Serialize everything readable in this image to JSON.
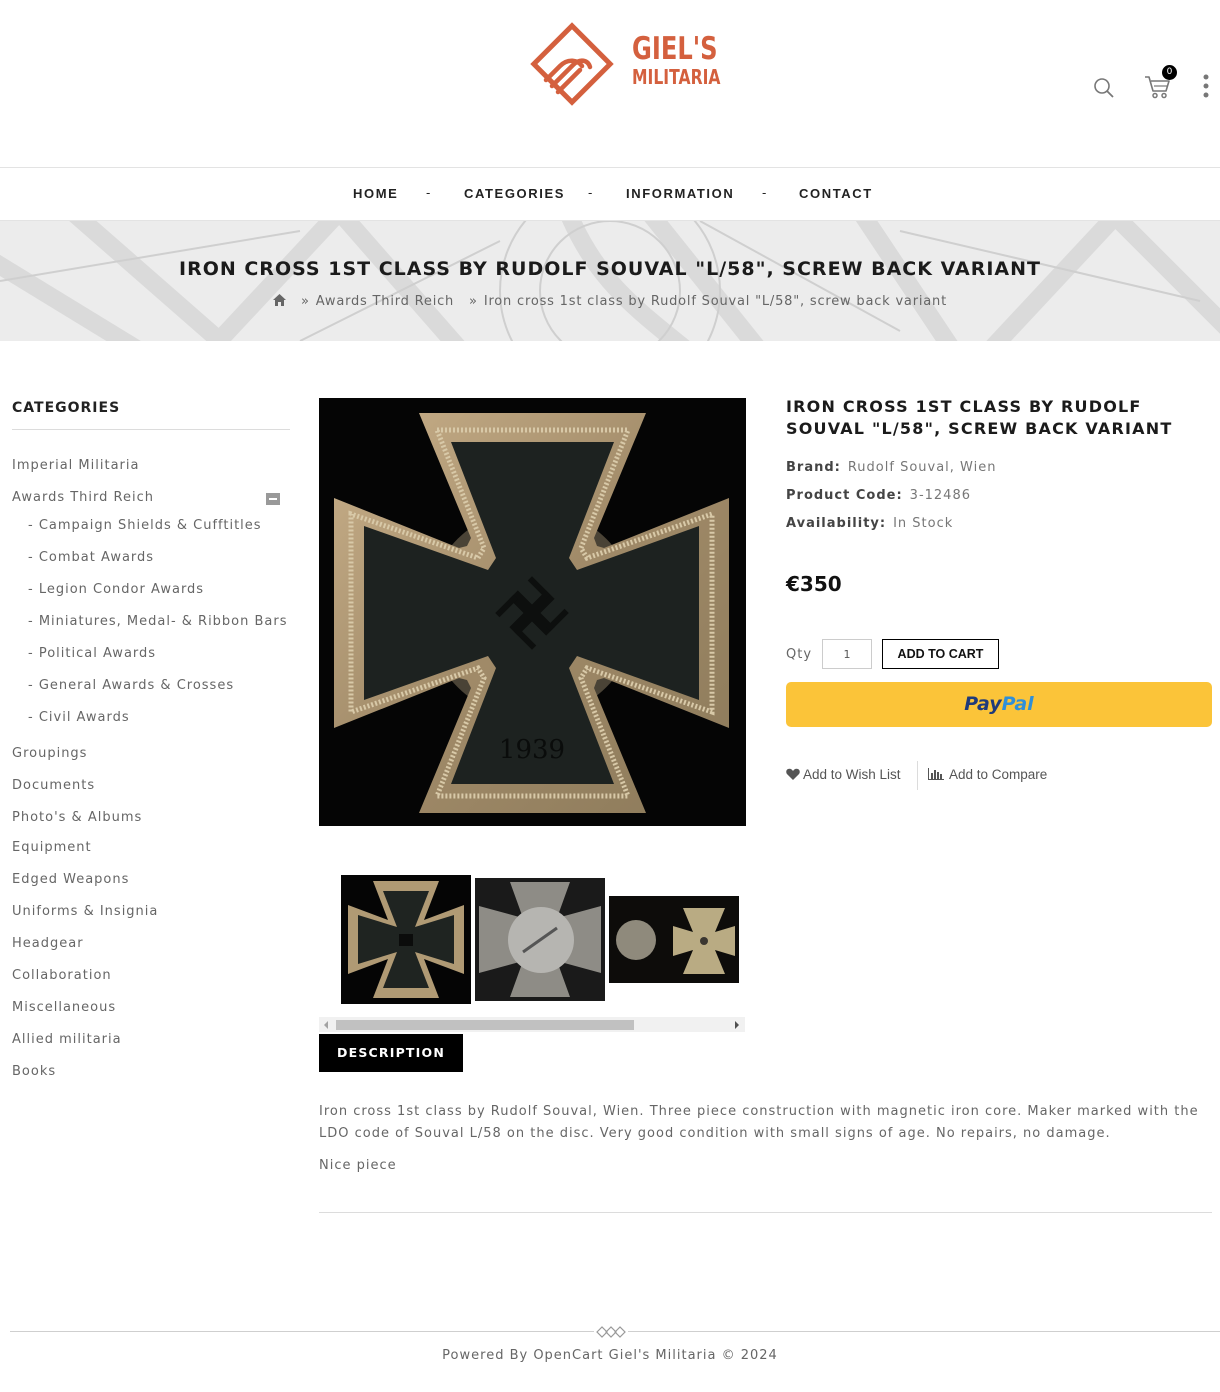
{
  "brand": {
    "line1": "GIEL'S",
    "line2": "MILITARIA",
    "color": "#d4603e"
  },
  "header": {
    "cart_count": "0",
    "icons": [
      "search-icon",
      "cart-icon",
      "more-vertical-icon"
    ]
  },
  "nav": {
    "items": [
      {
        "label": "HOME"
      },
      {
        "label": "CATEGORIES"
      },
      {
        "label": "INFORMATION"
      },
      {
        "label": "CONTACT"
      }
    ],
    "separator": "-"
  },
  "banner": {
    "title": "IRON CROSS 1ST CLASS BY RUDOLF SOUVAL \"L/58\", SCREW BACK VARIANT",
    "breadcrumbs": [
      {
        "label": "Awards Third Reich"
      },
      {
        "label": "Iron cross 1st class by Rudolf Souval \"L/58\", screw back variant"
      }
    ]
  },
  "sidebar": {
    "heading": "CATEGORIES",
    "items": [
      {
        "label": "Imperial Militaria"
      },
      {
        "label": "Awards Third Reich"
      },
      {
        "label": "- Campaign Shields & Cufftitles"
      },
      {
        "label": "- Combat Awards"
      },
      {
        "label": "- Legion Condor Awards"
      },
      {
        "label": "- Miniatures, Medal- & Ribbon Bars"
      },
      {
        "label": "- Political Awards"
      },
      {
        "label": "- General Awards & Crosses"
      },
      {
        "label": "- Civil Awards"
      },
      {
        "label": "Groupings"
      },
      {
        "label": "Documents"
      },
      {
        "label": "Photo's & Albums"
      },
      {
        "label": "Equipment"
      },
      {
        "label": "Edged Weapons"
      },
      {
        "label": "Uniforms & Insignia"
      },
      {
        "label": "Headgear"
      },
      {
        "label": "Collaboration"
      },
      {
        "label": "Miscellaneous"
      },
      {
        "label": "Allied militaria"
      },
      {
        "label": "Books"
      }
    ]
  },
  "product": {
    "title": "IRON CROSS 1ST CLASS BY RUDOLF SOUVAL \"L/58\", SCREW BACK VARIANT",
    "brand_label": "Brand:",
    "brand_value": "Rudolf Souval, Wien",
    "code_label": "Product Code:",
    "code_value": "3-12486",
    "availability_label": "Availability:",
    "availability_value": "In Stock",
    "price": "€350",
    "qty_label": "Qty",
    "qty_value": "1",
    "add_to_cart": "ADD TO CART",
    "paypal_1": "Pay",
    "paypal_2": "Pal",
    "wishlist": "Add to Wish List",
    "compare": "Add to Compare",
    "image_year": "1939"
  },
  "description": {
    "tab": "DESCRIPTION",
    "text": "Iron cross 1st class by Rudolf Souval, Wien. Three piece construction with magnetic iron core. Maker marked with the LDO code of Souval L/58 on the disc. Very good condition with small signs of age. No repairs, no damage.",
    "text2": "Nice piece"
  },
  "footer": {
    "text": "Powered By OpenCart Giel's Militaria © 2024"
  }
}
